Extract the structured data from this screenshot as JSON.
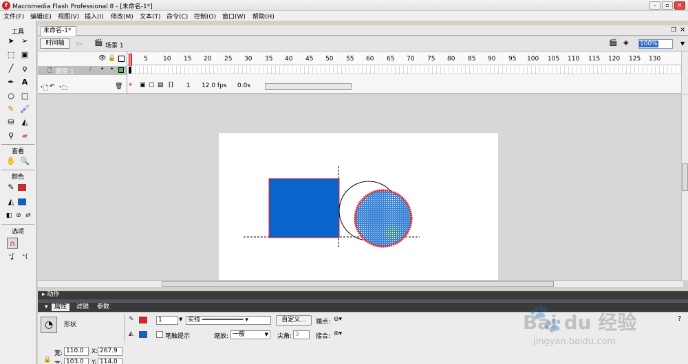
{
  "window": {
    "title": "Macromedia Flash Professional 8 - [未命名-1*]"
  },
  "menu": [
    "文件(F)",
    "编辑(E)",
    "视图(V)",
    "插入(I)",
    "修改(M)",
    "文本(T)",
    "命令(C)",
    "控制(O)",
    "窗口(W)",
    "帮助(H)"
  ],
  "tools": {
    "title": "工具",
    "view_label": "查看",
    "colors_label": "颜色",
    "options_label": "选项"
  },
  "document": {
    "tab": "未命名-1*"
  },
  "timeline": {
    "button": "时间轴",
    "scene": "场景 1",
    "zoom": "100%",
    "layer_name": "图层 1",
    "ruler_ticks": [
      "5",
      "10",
      "15",
      "20",
      "25",
      "30",
      "35",
      "40",
      "45",
      "50",
      "55",
      "60",
      "65",
      "70",
      "75",
      "80",
      "85",
      "90",
      "95",
      "100",
      "105",
      "110",
      "115",
      "120",
      "125",
      "130"
    ],
    "current_frame": "1",
    "fps": "12.0 fps",
    "elapsed": "0.0s"
  },
  "panels": {
    "actions": "动作"
  },
  "properties": {
    "tabs": [
      "属性",
      "滤镜",
      "参数"
    ],
    "object_type": "形状",
    "stroke_size": "1",
    "stroke_style": "实线",
    "custom_button": "自定义...",
    "cap_label": "端点:",
    "stroke_hint": "笔触提示",
    "scale_label": "缩放:",
    "scale_value": "一般",
    "miter_label": "尖角:",
    "miter_value": "3",
    "join_label": "接合:",
    "w_label": "宽:",
    "w_value": "110.0",
    "h_label": "高:",
    "h_value": "103.0",
    "x_label": "X:",
    "x_value": "267.9",
    "y_label": "Y:",
    "y_value": "114.0"
  },
  "watermark": {
    "brand": "Bai du 经验",
    "url": "jingyan.baidu.com"
  },
  "colors": {
    "stroke": "#ee1c1c",
    "fill": "#0a64cc",
    "stage": "#ffffff",
    "work_area": "#d7d7d7"
  }
}
